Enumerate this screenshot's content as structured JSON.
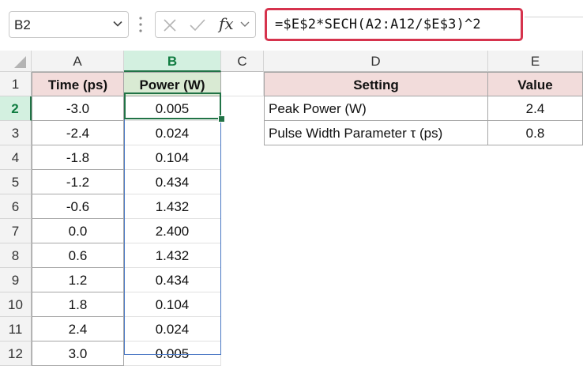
{
  "name_box": {
    "value": "B2",
    "icon": "chevron-down-icon"
  },
  "formula_bar": {
    "icons": [
      "cancel-x-icon",
      "enter-check-icon",
      "fx-icon",
      "chevron-down-icon"
    ],
    "fx_label": "fx",
    "formula": "=$E$2*SECH(A2:A12/$E$3)^2"
  },
  "columns": [
    "A",
    "B",
    "C",
    "D",
    "E"
  ],
  "selected_column": "B",
  "rows": [
    "1",
    "2",
    "3",
    "4",
    "5",
    "6",
    "7",
    "8",
    "9",
    "10",
    "11",
    "12"
  ],
  "selected_row": "2",
  "table": {
    "headers": {
      "time": "Time (ps)",
      "power": "Power (W)"
    },
    "time": [
      "-3.0",
      "-2.4",
      "-1.8",
      "-1.2",
      "-0.6",
      "0.0",
      "0.6",
      "1.2",
      "1.8",
      "2.4",
      "3.0"
    ],
    "power": [
      "0.005",
      "0.024",
      "0.104",
      "0.434",
      "1.432",
      "2.400",
      "1.432",
      "0.434",
      "0.104",
      "0.024",
      "0.005"
    ]
  },
  "settings": {
    "headers": {
      "setting": "Setting",
      "value": "Value"
    },
    "rows": [
      {
        "setting": "Peak Power (W)",
        "value": "2.4"
      },
      {
        "setting": "Pulse Width Parameter τ (ps)",
        "value": "0.8"
      }
    ]
  },
  "colors": {
    "formula_highlight": "#d6334d",
    "header_pink": "#f2dcdb",
    "header_green": "#d9ead3",
    "selection_green": "#217346",
    "range_blue": "#4a78c4"
  }
}
